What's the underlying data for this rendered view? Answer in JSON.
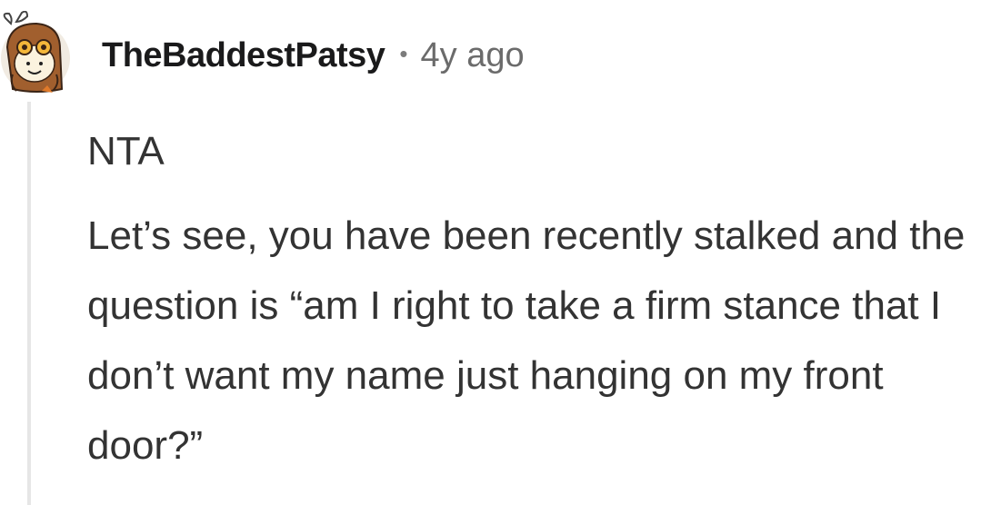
{
  "comment": {
    "author": "TheBaddestPatsy",
    "separator": "•",
    "age": "4y ago",
    "verdict": "NTA",
    "body": "Let’s see, you have been recently stalked and the question is “am I right to take a firm stance that I don’t want my name just hanging on my front door?”"
  },
  "colors": {
    "text": "#333333",
    "username": "#1a1a1b",
    "meta": "#6b6b6b",
    "thread_line": "#e6e6e6"
  },
  "icons": {
    "avatar": "owl-avatar-icon"
  }
}
